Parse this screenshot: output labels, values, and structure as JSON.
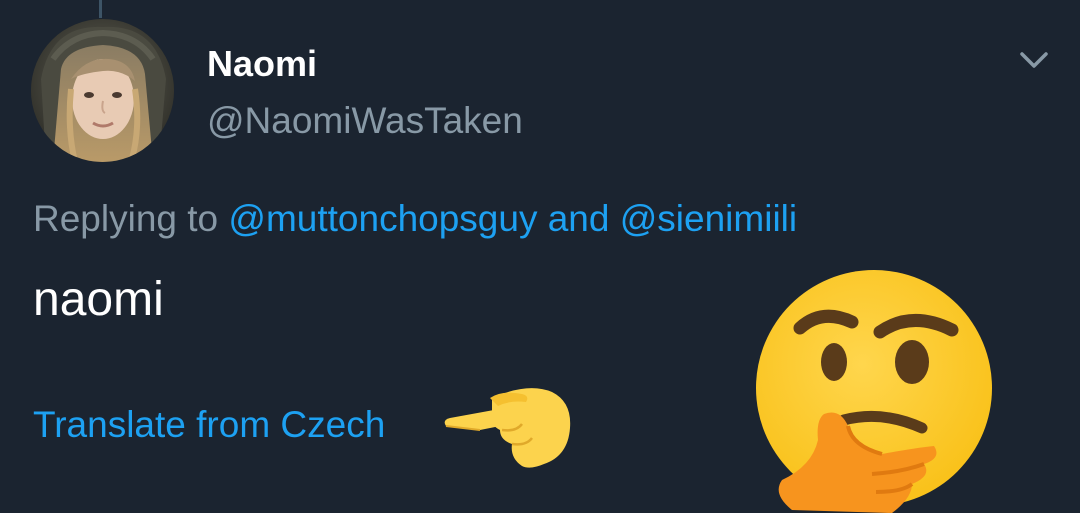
{
  "tweet": {
    "author": {
      "display_name": "Naomi",
      "handle": "@NaomiWasTaken",
      "avatar_icon": "profile-photo"
    },
    "menu_icon": "chevron-down-icon",
    "reply_context": {
      "prefix": "Replying to",
      "mention_1": "@muttonchopsguy",
      "conjunction": "and",
      "mention_2": "@sienimiili"
    },
    "text": "naomi",
    "translate_label": "Translate from Czech"
  },
  "overlays": {
    "pointing_hand": "pointing-right-emoji",
    "thinking_face": "thinking-face-emoji"
  },
  "colors": {
    "background": "#1b2430",
    "link": "#1da1f2",
    "muted": "#8899a6",
    "text": "#ffffff",
    "emoji_yellow": "#fcc21b",
    "hand_orange": "#f7941e"
  }
}
